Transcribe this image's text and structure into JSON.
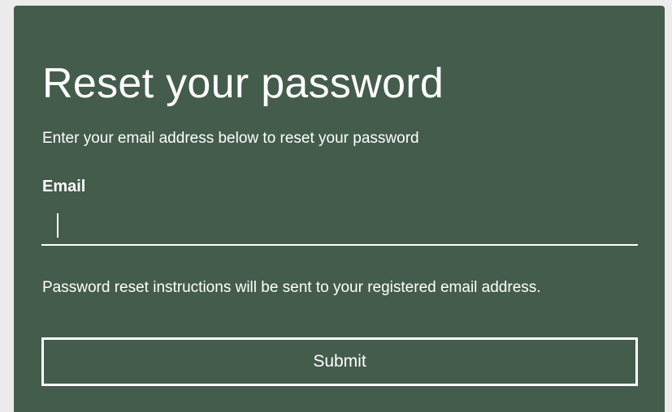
{
  "form": {
    "title": "Reset your password",
    "subtitle": "Enter your email address below to reset your password",
    "email_label": "Email",
    "email_value": "",
    "hint": "Password reset instructions will be sent to your registered email address.",
    "submit_label": "Submit"
  },
  "colors": {
    "panel_background": "#445c4c",
    "page_background": "#ececec",
    "text": "#ffffff"
  }
}
